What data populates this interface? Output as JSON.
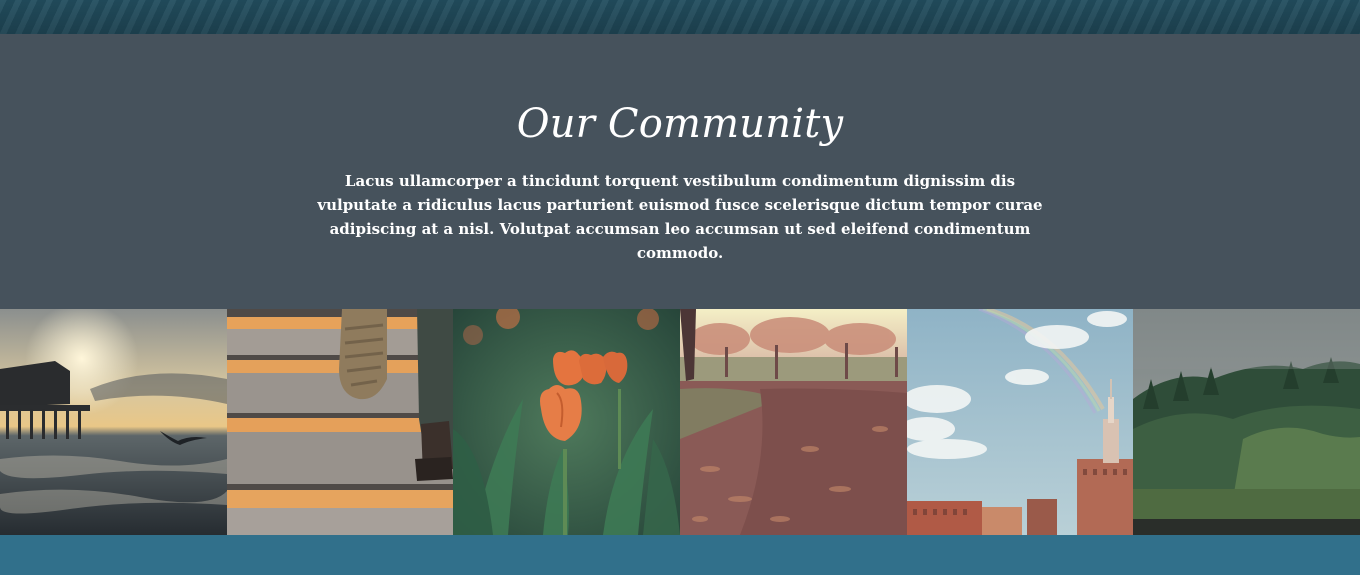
{
  "community": {
    "title": "Our Community",
    "description": "Lacus ullamcorper a tincidunt torquent vestibulum condimentum dignissim dis vulputate a ridiculus lacus parturient euismod fusce scelerisque dictum tempor curae adipiscing at a nisl. Volutpat accumsan leo accumsan ut sed eleifend condimentum commodo."
  },
  "gallery": {
    "images": [
      {
        "name": "pier-sunset-photo"
      },
      {
        "name": "stairs-shoes-photo"
      },
      {
        "name": "orange-tulips-photo"
      },
      {
        "name": "autumn-path-photo"
      },
      {
        "name": "city-rainbow-photo"
      },
      {
        "name": "misty-forest-photo"
      }
    ]
  },
  "colors": {
    "top_band": "#245264",
    "section_background": "#46525c",
    "bottom_band": "#31708b",
    "text": "#ffffff"
  }
}
